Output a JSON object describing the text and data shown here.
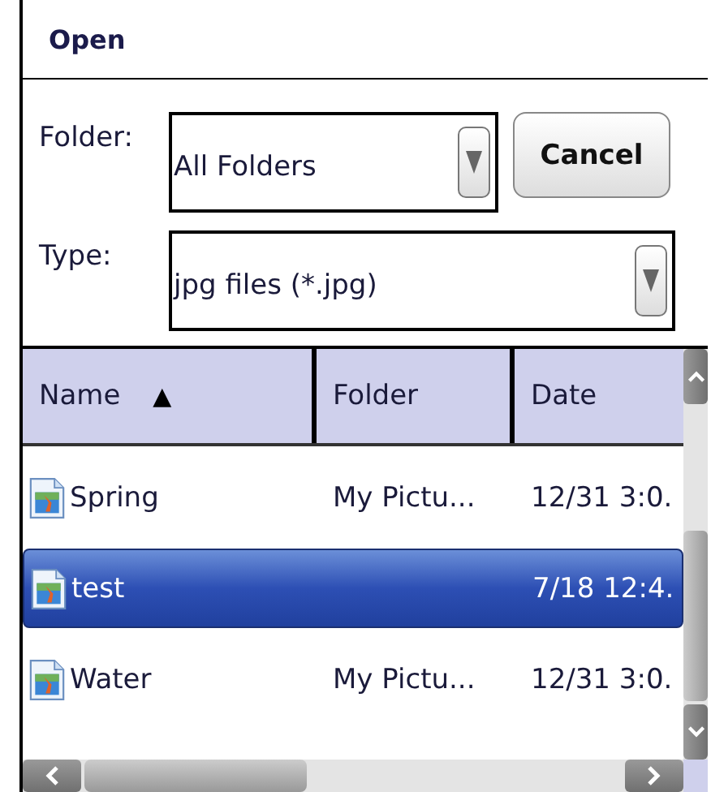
{
  "window": {
    "title": "Open"
  },
  "folder": {
    "label": "Folder:",
    "value": "All Folders"
  },
  "cancel_button": "Cancel",
  "type": {
    "label": "Type:",
    "value": "jpg files (*.jpg)"
  },
  "table": {
    "columns": [
      {
        "label": "Name",
        "sort": "▲"
      },
      {
        "label": "Folder"
      },
      {
        "label": "Date"
      }
    ],
    "rows": [
      {
        "name": "Spring",
        "folder": "My Pictu...",
        "date": "12/31 3:0.",
        "selected": false
      },
      {
        "name": "test",
        "date": "7/18 12:4.",
        "selected": true
      },
      {
        "name": "Water",
        "folder": "My Pictu...",
        "date": "12/31 3:0.",
        "selected": false
      }
    ]
  }
}
